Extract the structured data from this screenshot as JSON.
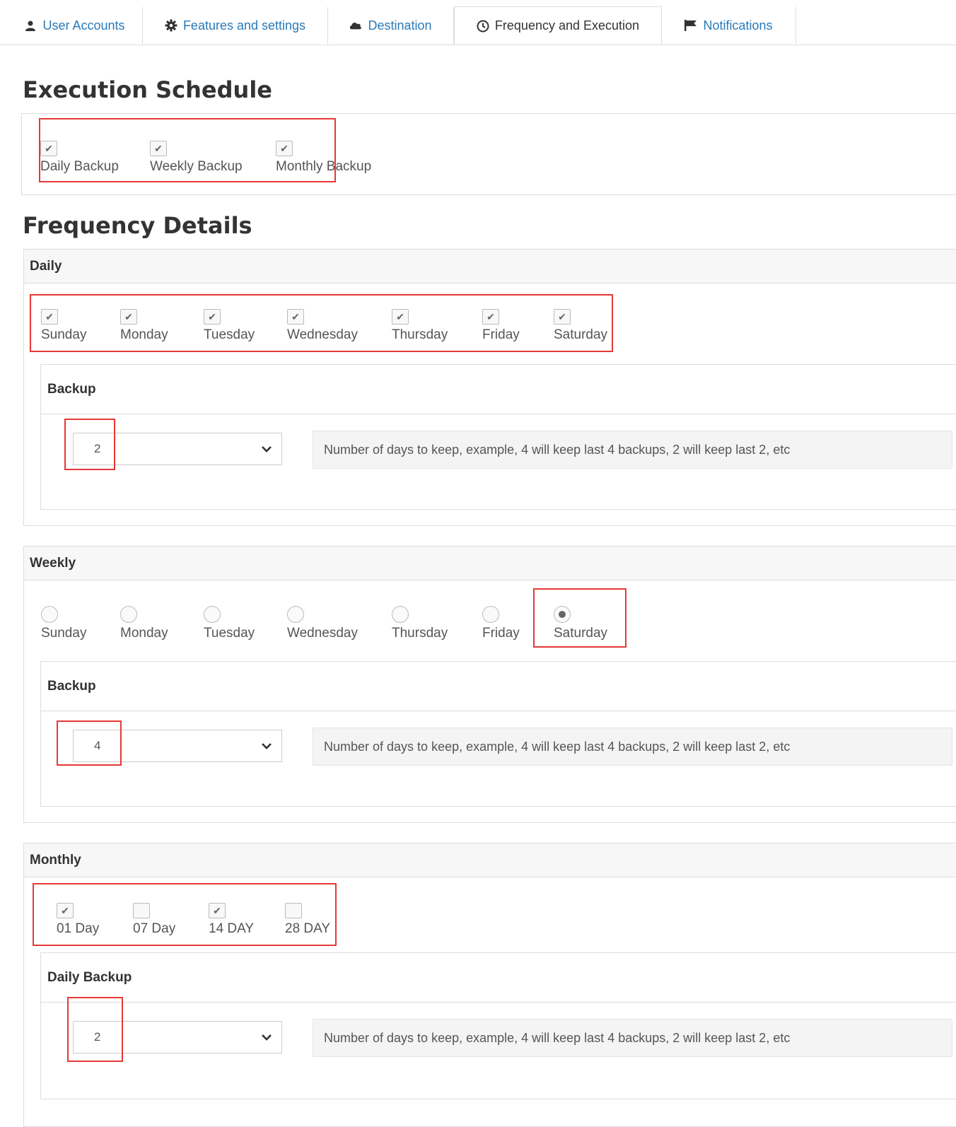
{
  "tabs": [
    {
      "label": "User Accounts",
      "icon": "user-icon"
    },
    {
      "label": "Features and settings",
      "icon": "gear-icon"
    },
    {
      "label": "Destination",
      "icon": "cloud-icon"
    },
    {
      "label": "Frequency and Execution",
      "icon": "clock-icon",
      "active": true
    },
    {
      "label": "Notifications",
      "icon": "flag-icon"
    }
  ],
  "execution_schedule": {
    "title": "Execution Schedule",
    "options": [
      {
        "label": "Daily Backup",
        "checked": true
      },
      {
        "label": "Weekly Backup",
        "checked": true
      },
      {
        "label": "Monthly Backup",
        "checked": true
      }
    ]
  },
  "frequency_details": {
    "title": "Frequency Details",
    "daily": {
      "header": "Daily",
      "days": [
        {
          "label": "Sunday",
          "checked": true
        },
        {
          "label": "Monday",
          "checked": true
        },
        {
          "label": "Tuesday",
          "checked": true
        },
        {
          "label": "Wednesday",
          "checked": true
        },
        {
          "label": "Thursday",
          "checked": true
        },
        {
          "label": "Friday",
          "checked": true
        },
        {
          "label": "Saturday",
          "checked": true
        }
      ],
      "backup": {
        "header": "Backup",
        "value": "2",
        "hint": "Number of days to keep, example, 4 will keep last 4 backups, 2 will keep last 2, etc"
      }
    },
    "weekly": {
      "header": "Weekly",
      "days": [
        {
          "label": "Sunday",
          "selected": false
        },
        {
          "label": "Monday",
          "selected": false
        },
        {
          "label": "Tuesday",
          "selected": false
        },
        {
          "label": "Wednesday",
          "selected": false
        },
        {
          "label": "Thursday",
          "selected": false
        },
        {
          "label": "Friday",
          "selected": false
        },
        {
          "label": "Saturday",
          "selected": true
        }
      ],
      "backup": {
        "header": "Backup",
        "value": "4",
        "hint": "Number of days to keep, example, 4 will keep last 4 backups, 2 will keep last 2, etc"
      }
    },
    "monthly": {
      "header": "Monthly",
      "days": [
        {
          "label": "01 Day",
          "checked": true
        },
        {
          "label": "07 Day",
          "checked": false
        },
        {
          "label": "14 DAY",
          "checked": true
        },
        {
          "label": "28 DAY",
          "checked": false
        }
      ],
      "backup": {
        "header": "Daily Backup",
        "value": "2",
        "hint": "Number of days to keep, example, 4 will keep last 4 backups, 2 will keep last 2, etc"
      }
    }
  },
  "colors": {
    "link": "#2a7ab8",
    "highlight": "#e53935"
  }
}
